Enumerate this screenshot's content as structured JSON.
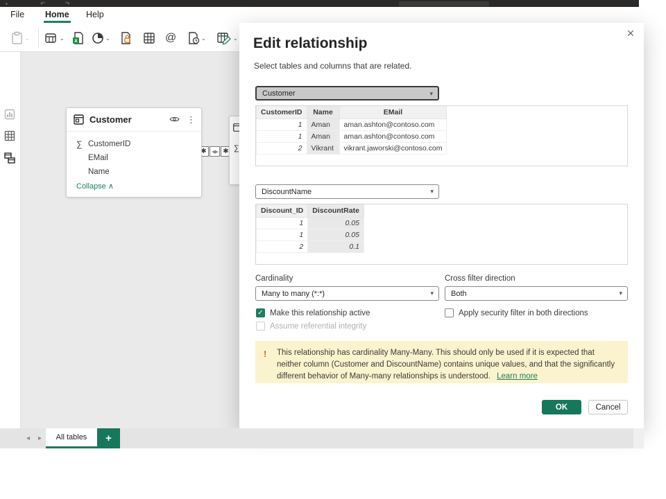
{
  "menu": {
    "file": "File",
    "home": "Home",
    "help": "Help"
  },
  "canvas": {
    "customer_card": {
      "title": "Customer",
      "fields": [
        {
          "name": "CustomerID",
          "icon": "sigma"
        },
        {
          "name": "EMail",
          "icon": ""
        },
        {
          "name": "Name",
          "icon": ""
        }
      ],
      "collapse_label": "Collapse"
    },
    "relationship_connector": {
      "left_cardinality": "✱",
      "direction": "◀▶",
      "right_cardinality": "✱"
    }
  },
  "dialog": {
    "title": "Edit relationship",
    "subtitle": "Select tables and columns that are related.",
    "table1": {
      "selected_table": "Customer",
      "columns": [
        "CustomerID",
        "Name",
        "EMail"
      ],
      "selected_column": "Name",
      "rows": [
        [
          "1",
          "Aman",
          "aman.ashton@contoso.com"
        ],
        [
          "1",
          "Aman",
          "aman.ashton@contoso.com"
        ],
        [
          "2",
          "Vikrant",
          "vikrant.jaworski@contoso.com"
        ]
      ]
    },
    "table2": {
      "selected_table": "DiscountName",
      "columns": [
        "Discount_ID",
        "DiscountRate"
      ],
      "selected_column": "DiscountRate",
      "rows": [
        [
          "1",
          "0.05"
        ],
        [
          "1",
          "0.05"
        ],
        [
          "2",
          "0.1"
        ]
      ]
    },
    "cardinality": {
      "label": "Cardinality",
      "value": "Many to many (*:*)"
    },
    "cross_filter": {
      "label": "Cross filter direction",
      "value": "Both"
    },
    "checkboxes": {
      "active": {
        "label": "Make this relationship active",
        "checked": true
      },
      "security": {
        "label": "Apply security filter in both directions",
        "checked": false
      },
      "referential": {
        "label": "Assume referential integrity",
        "checked": false,
        "disabled": true
      }
    },
    "warning": {
      "text": "This relationship has cardinality Many-Many. This should only be used if it is expected that neither column (Customer and DiscountName) contains unique values, and that the significantly different behavior of Many-many relationships is understood.",
      "link": "Learn more"
    },
    "ok_label": "OK",
    "cancel_label": "Cancel"
  },
  "tabbar": {
    "nav_left": "◂",
    "nav_right": "▸",
    "tab_label": "All tables",
    "add_label": "+"
  },
  "glyphs": {
    "checkmark": "✓",
    "close": "✕",
    "kebab": "⋮",
    "sigma": "∑",
    "collapse_caret": "∧",
    "dropdown_caret": "▾",
    "toolbar_caret": "⌄",
    "warning_mark": "!"
  },
  "colors": {
    "accent_green": "#17775a",
    "underline_green": "#1b7f5f",
    "warning_bg": "#fbf3cd",
    "canvas_gray": "#eaeaea",
    "titlebar_dark": "#2b2a29"
  }
}
